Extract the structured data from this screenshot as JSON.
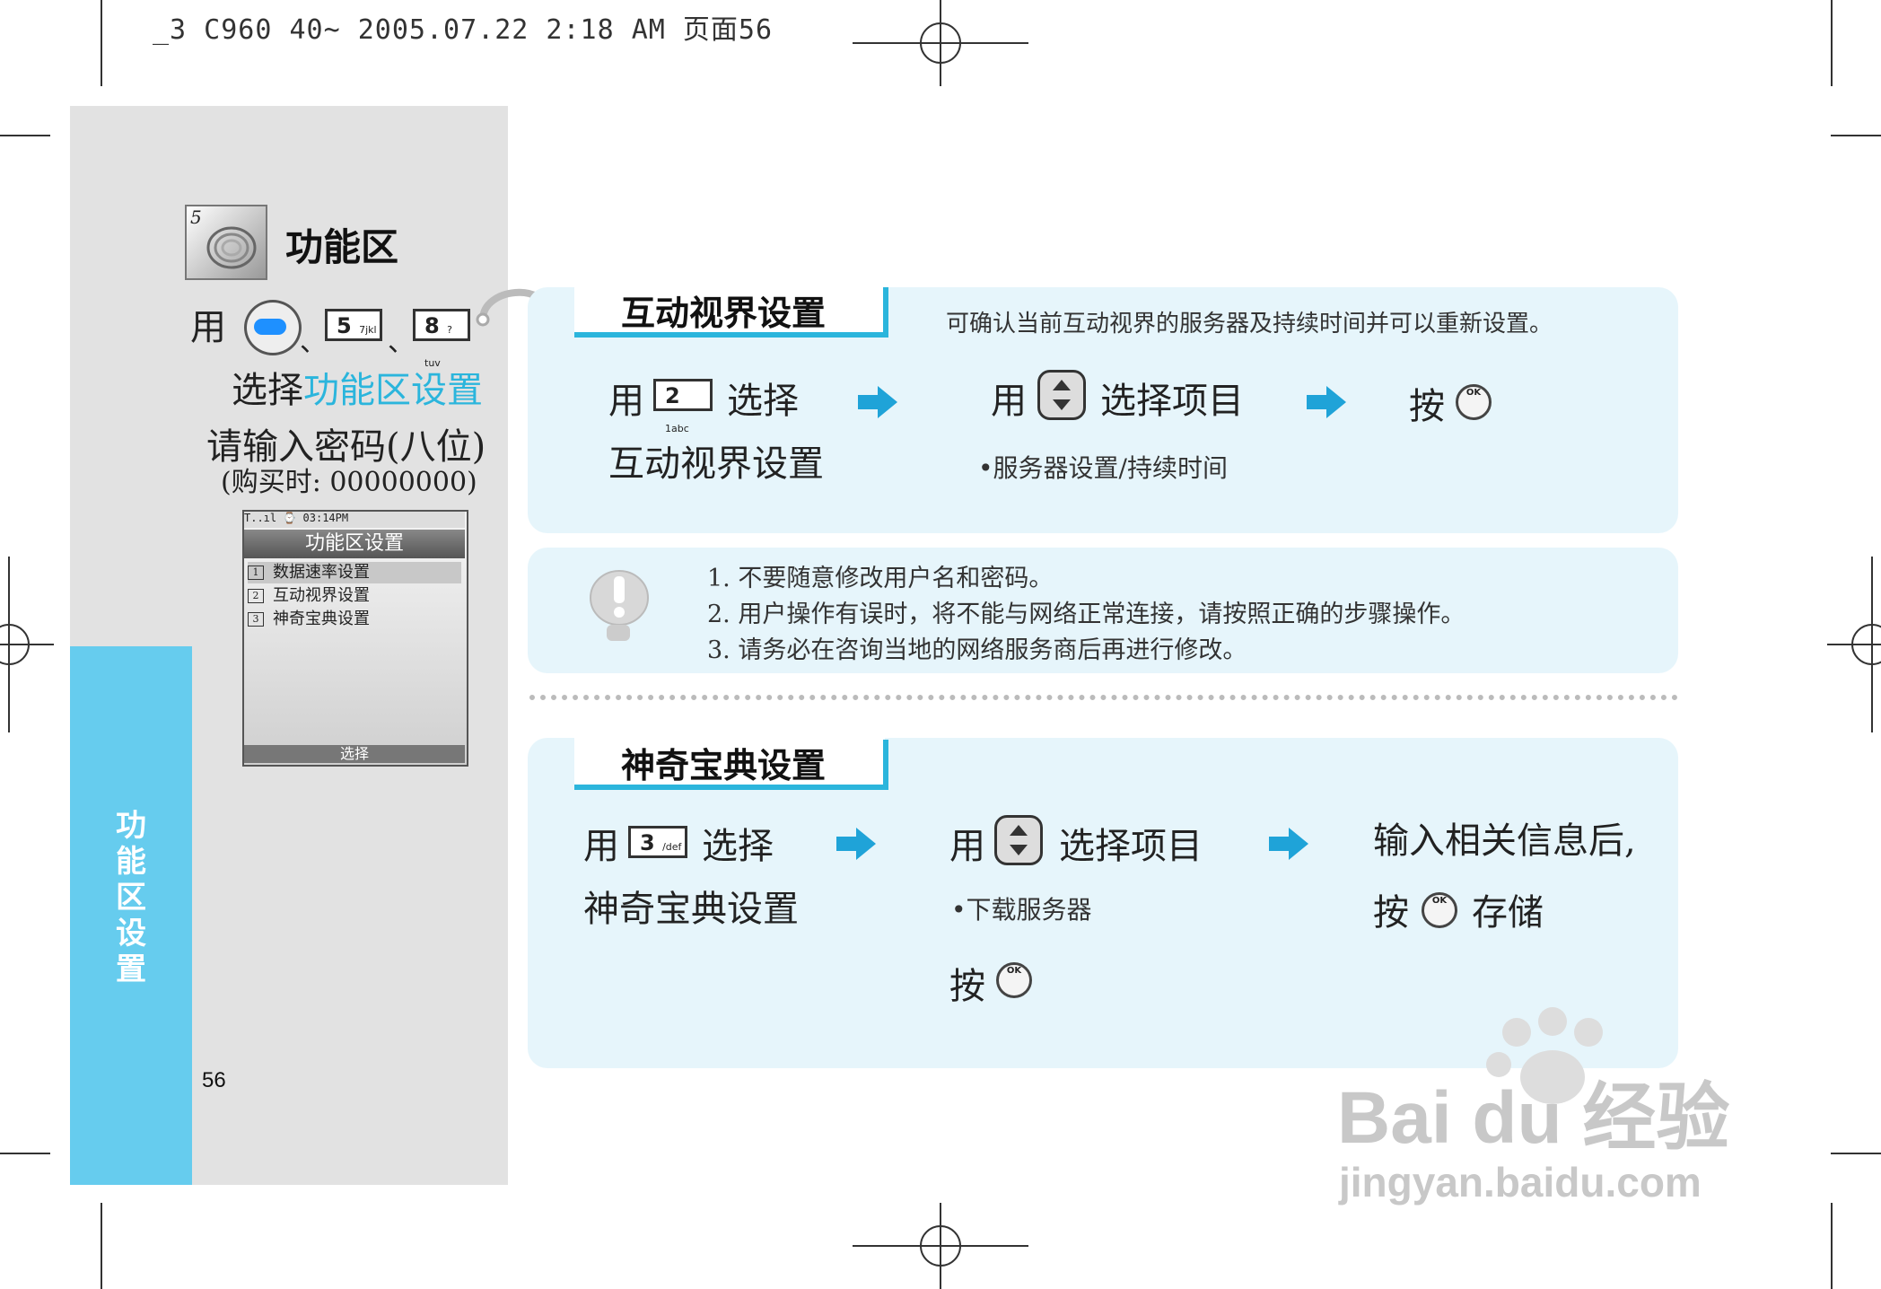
{
  "header": {
    "print_line": "_3 C960 40~ 2005.07.22 2:18 AM 页面56"
  },
  "left": {
    "icon_number": "5",
    "title": "功能区",
    "use_word": "用",
    "keys": [
      {
        "digit": "5",
        "letters": "jkl",
        "sup": "7"
      },
      {
        "digit": "8",
        "letters": "tuv",
        "sup": "?"
      }
    ],
    "separator": "、",
    "select_prefix": "选择",
    "select_target": "功能区设置",
    "password_prompt": "请输入密码(八位)",
    "password_note": "(购买时: 00000000)",
    "side_tab": [
      "功",
      "能",
      "区",
      "设",
      "置"
    ],
    "page_number": "56"
  },
  "phone_screen": {
    "status": "T..ıl   ⌚   03:14PM",
    "title": "功能区设置",
    "items": [
      {
        "num": "1",
        "label": "数据速率设置"
      },
      {
        "num": "2",
        "label": "互动视界设置"
      },
      {
        "num": "3",
        "label": "神奇宝典设置"
      }
    ],
    "softkey": "选择"
  },
  "section1": {
    "title": "互动视界设置",
    "description": "可确认当前互动视界的服务器及持续时间并可以重新设置。",
    "step1_use": "用",
    "step1_key": {
      "digit": "2",
      "letters": "abc",
      "sup": "1"
    },
    "step1_select": "选择",
    "step1_target": "互动视界设置",
    "step2_use": "用",
    "step2_text": "选择项目",
    "step2_bullet": "•服务器设置/持续时间",
    "step3_text": "按",
    "ok_label": "OK"
  },
  "notes": {
    "items": [
      "1. 不要随意修改用户名和密码。",
      "2. 用户操作有误时，将不能与网络正常连接，请按照正确的步骤操作。",
      "3. 请务必在咨询当地的网络服务商后再进行修改。"
    ]
  },
  "section2": {
    "title": "神奇宝典设置",
    "step1_use": "用",
    "step1_key": {
      "digit": "3",
      "letters": "def",
      "sup": "/"
    },
    "step1_select": "选择",
    "step1_target": "神奇宝典设置",
    "step2_use": "用",
    "step2_text": "选择项目",
    "step2_bullet": "•下载服务器",
    "step2_press": "按",
    "step3_line1": "输入相关信息后,",
    "step3_press": "按",
    "step3_save": "存储",
    "ok_label": "OK"
  },
  "watermark": {
    "brand": "Bai du 经验",
    "url": "jingyan.baidu.com"
  },
  "colors": {
    "accent": "#2bb5dc",
    "side_tab": "#66ccee",
    "panel": "#e2e2e2",
    "box": "#e6f5fb"
  }
}
